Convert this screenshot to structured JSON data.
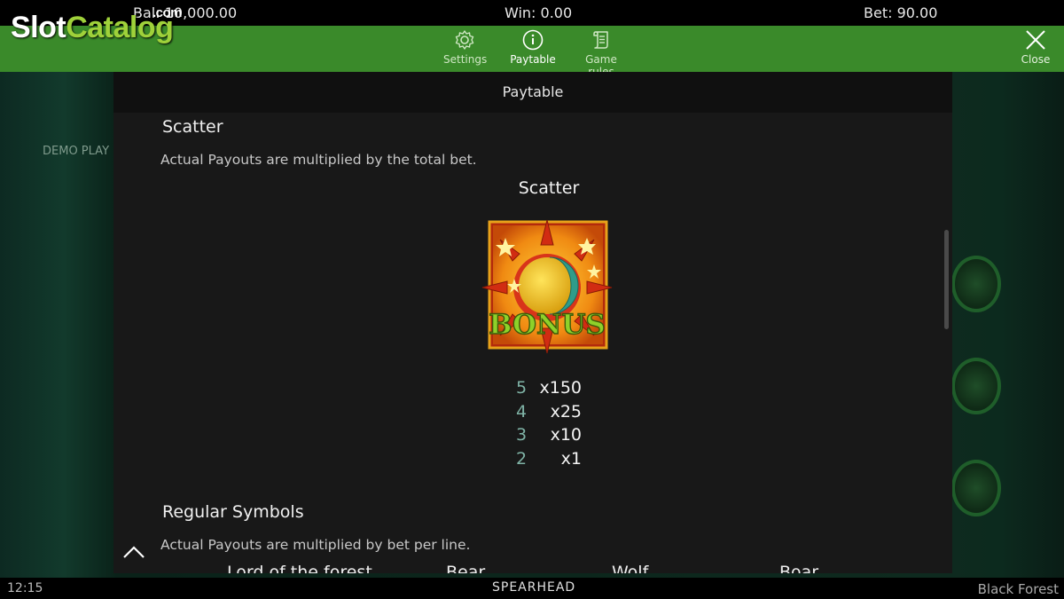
{
  "topbar": {
    "balance": "Bal: 10,000.00",
    "win": "Win:  0.00",
    "bet": "Bet: 90.00"
  },
  "logo": {
    "slot": "Slot",
    "catalog": "Catalog",
    "com": ".com"
  },
  "menu": {
    "settings": "Settings",
    "paytable": "Paytable",
    "rules": "Game rules",
    "close": "Close"
  },
  "scene": {
    "demo_label": "DEMO PLAY"
  },
  "panel": {
    "header": "Paytable",
    "scatter_section": "Scatter",
    "scatter_note": "Actual Payouts are multiplied by the total bet.",
    "symbol_title": "Scatter",
    "symbol_text": "BONUS",
    "pays": [
      {
        "count": "5",
        "value": "x150"
      },
      {
        "count": "4",
        "value": "x25"
      },
      {
        "count": "3",
        "value": "x10"
      },
      {
        "count": "2",
        "value": "x1"
      }
    ],
    "regular_section": "Regular Symbols",
    "regular_note": "Actual Payouts are multiplied by bet per line.",
    "next_symbols": [
      "Lord of the forest",
      "Bear",
      "Wolf",
      "Boar"
    ]
  },
  "bottombar": {
    "time": "12:15",
    "brand": "SPEARHEAD",
    "game": "Black Forest"
  },
  "colors": {
    "menu_green": "#3a8a2a",
    "panel_bg": "#181818",
    "pay_count": "#7fb3a6",
    "bonus_text": "#8ed12a"
  }
}
